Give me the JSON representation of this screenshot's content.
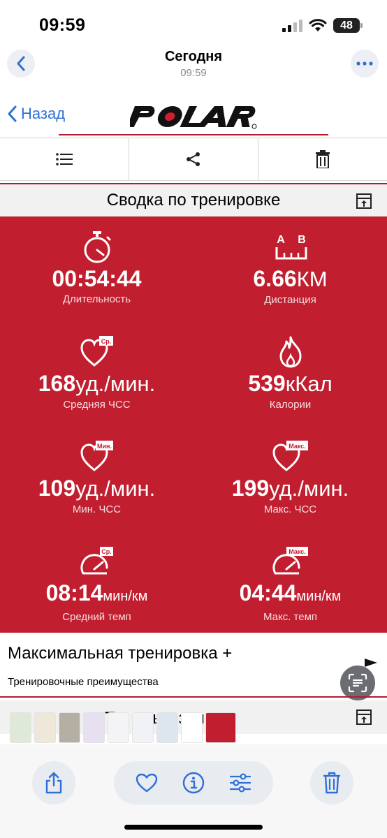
{
  "status_bar": {
    "time": "09:59",
    "battery": "48"
  },
  "nav": {
    "title": "Сегодня",
    "subtitle": "09:59"
  },
  "header": {
    "back_label": "Назад",
    "logo_text": "POLAR"
  },
  "summary": {
    "title": "Сводка по тренировке",
    "stats": [
      {
        "id": "duration",
        "value": "00:54:44",
        "unit": "",
        "label": "Длительность",
        "icon": "stopwatch-icon"
      },
      {
        "id": "distance",
        "value": "6.66",
        "unit": "КМ",
        "label": "Дистанция",
        "icon": "distance-ab-icon",
        "icon_text_a": "A",
        "icon_text_b": "B"
      },
      {
        "id": "avg-hr",
        "value": "168",
        "unit": "уд./мин.",
        "label": "Средняя ЧСС",
        "icon": "heart-avg-icon",
        "badge": "Ср."
      },
      {
        "id": "calories",
        "value": "539",
        "unit": "кКал",
        "label": "Калории",
        "icon": "flame-icon"
      },
      {
        "id": "min-hr",
        "value": "109",
        "unit": "уд./мин.",
        "label": "Мин. ЧСС",
        "icon": "heart-min-icon",
        "badge": "Мин."
      },
      {
        "id": "max-hr",
        "value": "199",
        "unit": "уд./мин.",
        "label": "Макс. ЧСС",
        "icon": "heart-max-icon",
        "badge": "Макс."
      },
      {
        "id": "avg-pace",
        "value": "08:14",
        "unit": "мин/км",
        "label": "Средний темп",
        "icon": "gauge-avg-icon",
        "badge": "Ср."
      },
      {
        "id": "max-pace",
        "value": "04:44",
        "unit": "мин/км",
        "label": "Макс. темп",
        "icon": "gauge-max-icon",
        "badge": "Макс."
      }
    ]
  },
  "benefit": {
    "title": "Максимальная тренировка +",
    "subtitle": "Тренировочные преимущества"
  },
  "zones": {
    "title_partial": "ные зоны",
    "title_visible_start": "Т"
  },
  "colors": {
    "polar_red": "#c11f30",
    "link_blue": "#2f6fd8",
    "ios_blue": "#2f6fd8"
  }
}
